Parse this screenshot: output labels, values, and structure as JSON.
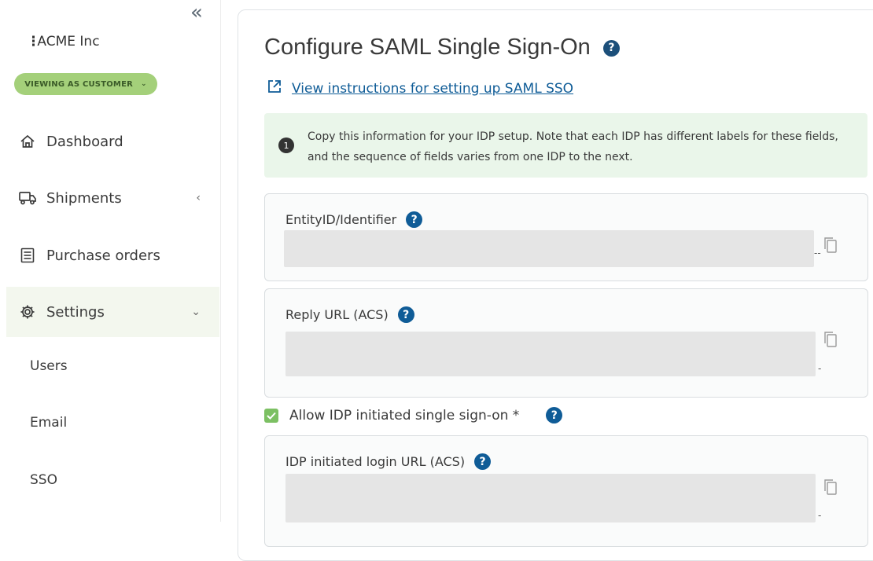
{
  "sidebar": {
    "collapse_glyph": "«",
    "org_name": "ACME Inc",
    "org_menu_glyph": "⋮",
    "viewing_badge": "VIEWING AS CUSTOMER",
    "nav": [
      {
        "label": "Dashboard",
        "icon": "home-icon"
      },
      {
        "label": "Shipments",
        "icon": "truck-icon",
        "arrow": "‹"
      },
      {
        "label": "Purchase orders",
        "icon": "document-list-icon"
      },
      {
        "label": "Settings",
        "icon": "gear-icon",
        "arrow": "⌄"
      }
    ],
    "sub_items": [
      "Users",
      "Email",
      "SSO"
    ]
  },
  "main": {
    "title": "Configure SAML Single Sign-On",
    "instructions_link": "View instructions for setting up SAML SSO",
    "notice": {
      "number": "1",
      "text": "Copy this information for your IDP setup. Note that each IDP has different labels for these fields, and the sequence of fields varies from one IDP to the next."
    },
    "fields": [
      {
        "label": "EntityID/Identifier",
        "value": ""
      },
      {
        "label": "Reply URL (ACS)",
        "value": ""
      },
      {
        "label": "IDP initiated login URL (ACS)",
        "value": ""
      }
    ],
    "allow_idp": {
      "label": "Allow IDP initiated single sign-on *",
      "checked": true
    },
    "help_glyph": "?"
  },
  "colors": {
    "accent_green": "#a4d07a",
    "help_blue": "#0f5c97",
    "notice_bg": "#eaf6ea",
    "checkbox_green": "#7cc063"
  }
}
